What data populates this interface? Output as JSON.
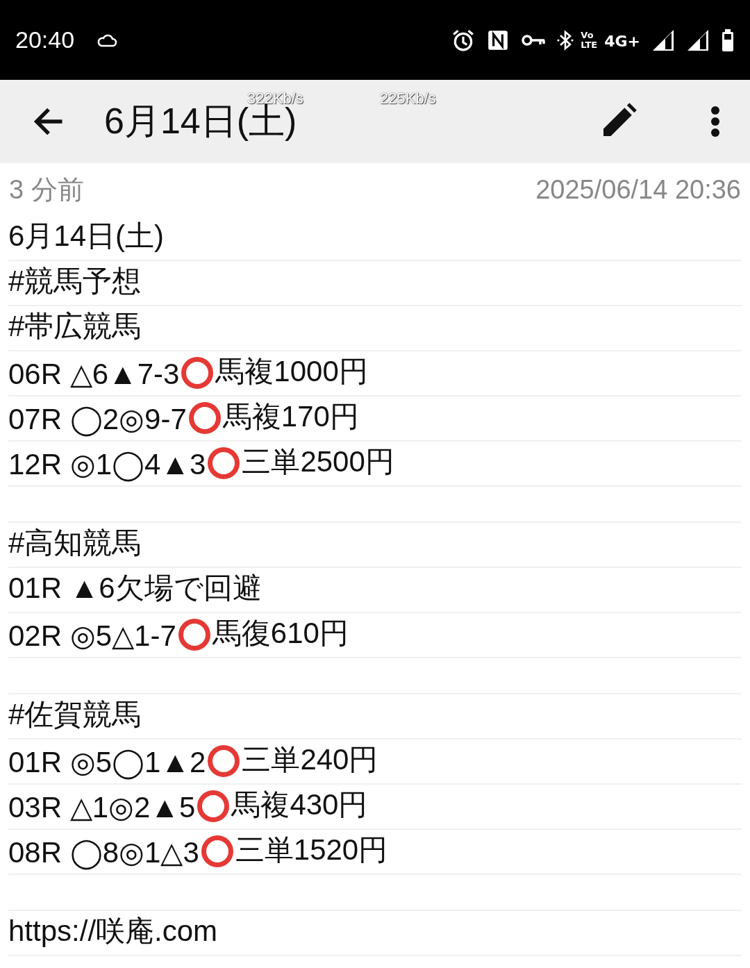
{
  "status_bar": {
    "time": "20:40",
    "volte_top": "Vo",
    "volte_bottom": "LTE",
    "network": "4G+"
  },
  "speed_overlay": [
    "322Kb/s",
    "225Kb/s"
  ],
  "app_bar": {
    "title": "6月14日(土)"
  },
  "meta": {
    "relative_time": "3 分前",
    "timestamp": "2025/06/14 20:36"
  },
  "lines": [
    {
      "kind": "text",
      "segments": [
        {
          "kind": "text",
          "text": "6月14日(土)"
        }
      ]
    },
    {
      "kind": "text",
      "segments": [
        {
          "kind": "text",
          "text": "#競馬予想"
        }
      ]
    },
    {
      "kind": "text",
      "segments": [
        {
          "kind": "text",
          "text": "#帯広競馬"
        }
      ]
    },
    {
      "kind": "text",
      "segments": [
        {
          "kind": "text",
          "text": "06R △6▲7-3"
        },
        {
          "kind": "ring"
        },
        {
          "kind": "text",
          "text": "馬複1000円"
        }
      ]
    },
    {
      "kind": "text",
      "segments": [
        {
          "kind": "text",
          "text": "07R ◯2◎9-7"
        },
        {
          "kind": "ring"
        },
        {
          "kind": "text",
          "text": "馬複170円"
        }
      ]
    },
    {
      "kind": "text",
      "segments": [
        {
          "kind": "text",
          "text": "12R ◎1◯4▲3"
        },
        {
          "kind": "ring"
        },
        {
          "kind": "text",
          "text": "三単2500円"
        }
      ]
    },
    {
      "kind": "blank"
    },
    {
      "kind": "text",
      "segments": [
        {
          "kind": "text",
          "text": "#高知競馬"
        }
      ]
    },
    {
      "kind": "text",
      "segments": [
        {
          "kind": "text",
          "text": "01R ▲6欠場で回避"
        }
      ]
    },
    {
      "kind": "text",
      "segments": [
        {
          "kind": "text",
          "text": "02R ◎5△1-7"
        },
        {
          "kind": "ring"
        },
        {
          "kind": "text",
          "text": "馬復610円"
        }
      ]
    },
    {
      "kind": "blank"
    },
    {
      "kind": "text",
      "segments": [
        {
          "kind": "text",
          "text": "#佐賀競馬"
        }
      ]
    },
    {
      "kind": "text",
      "segments": [
        {
          "kind": "text",
          "text": "01R ◎5◯1▲2"
        },
        {
          "kind": "ring"
        },
        {
          "kind": "text",
          "text": "三単240円"
        }
      ]
    },
    {
      "kind": "text",
      "segments": [
        {
          "kind": "text",
          "text": "03R △1◎2▲5"
        },
        {
          "kind": "ring"
        },
        {
          "kind": "text",
          "text": "馬複430円"
        }
      ]
    },
    {
      "kind": "text",
      "segments": [
        {
          "kind": "text",
          "text": "08R ◯8◎1△3"
        },
        {
          "kind": "ring"
        },
        {
          "kind": "text",
          "text": "三単1520円"
        }
      ]
    },
    {
      "kind": "blank"
    },
    {
      "kind": "text",
      "segments": [
        {
          "kind": "text",
          "text": "https://咲庵.com"
        }
      ]
    }
  ]
}
